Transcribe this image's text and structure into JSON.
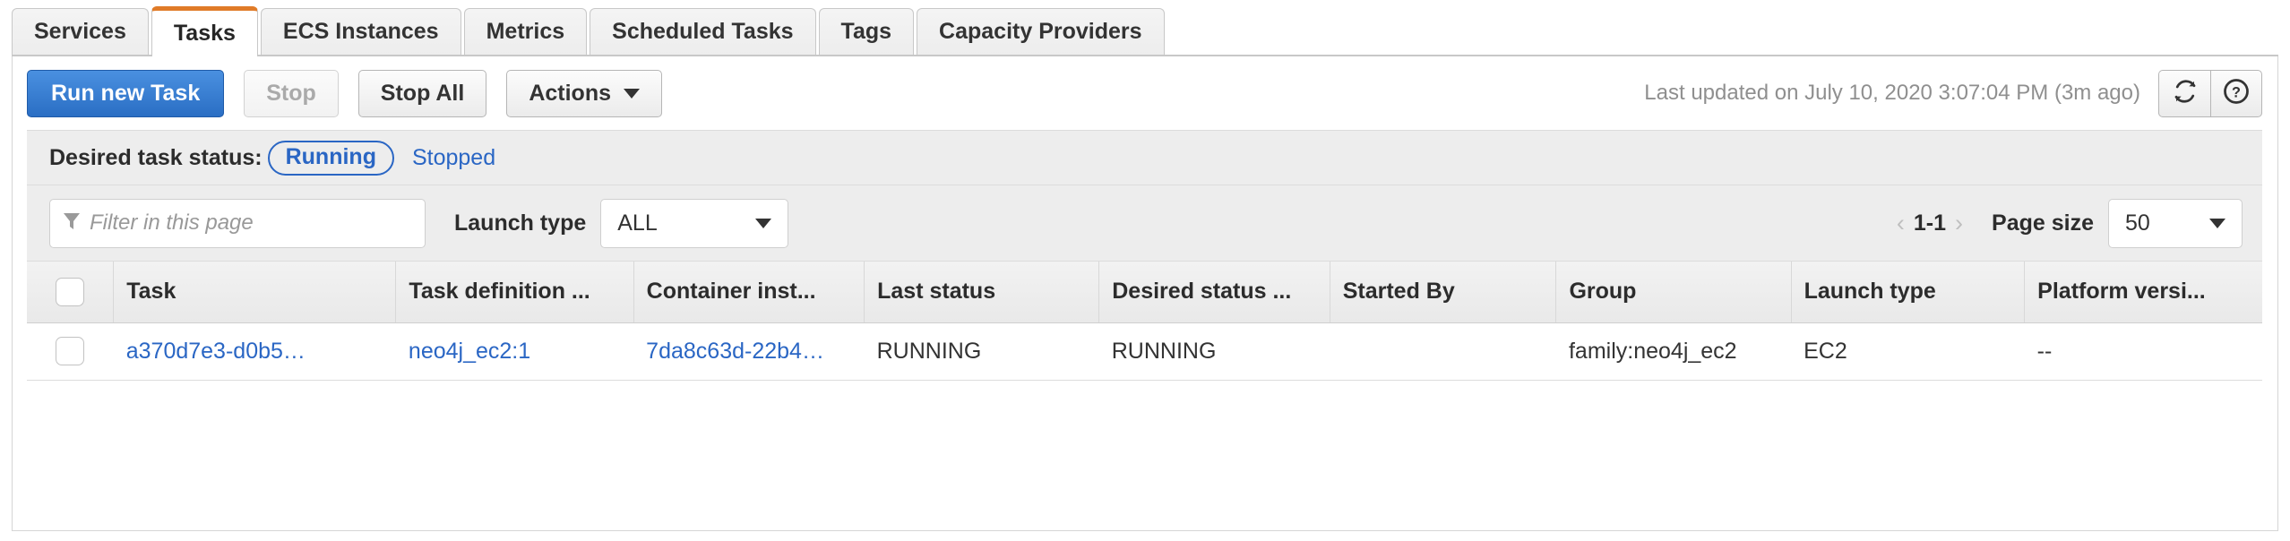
{
  "tabs": [
    {
      "label": "Services",
      "active": false
    },
    {
      "label": "Tasks",
      "active": true
    },
    {
      "label": "ECS Instances",
      "active": false
    },
    {
      "label": "Metrics",
      "active": false
    },
    {
      "label": "Scheduled Tasks",
      "active": false
    },
    {
      "label": "Tags",
      "active": false
    },
    {
      "label": "Capacity Providers",
      "active": false
    }
  ],
  "toolbar": {
    "run_new_task": "Run new Task",
    "stop": "Stop",
    "stop_all": "Stop All",
    "actions": "Actions",
    "last_updated": "Last updated on July 10, 2020 3:07:04 PM (3m ago)",
    "refresh_icon": "refresh-icon",
    "help_icon": "help-icon"
  },
  "filters": {
    "desired_task_status_label": "Desired task status:",
    "status_running": "Running",
    "status_stopped": "Stopped",
    "filter_placeholder": "Filter in this page",
    "filter_value": "",
    "filter_icon": "funnel-icon",
    "launch_type_label": "Launch type",
    "launch_type_value": "ALL",
    "page_range": "1-1",
    "prev_icon": "chevron-left-icon",
    "next_icon": "chevron-right-icon",
    "page_size_label": "Page size",
    "page_size_value": "50"
  },
  "table": {
    "columns": [
      "Task",
      "Task definition ...",
      "Container inst...",
      "Last status",
      "Desired status ...",
      "Started By",
      "Group",
      "Launch type",
      "Platform versi..."
    ],
    "rows": [
      {
        "task": "a370d7e3-d0b5…",
        "task_definition": "neo4j_ec2:1",
        "container_instance": "7da8c63d-22b4…",
        "last_status": "RUNNING",
        "desired_status": "RUNNING",
        "started_by": "",
        "group": "family:neo4j_ec2",
        "launch_type": "EC2",
        "platform_version": "--"
      }
    ]
  },
  "colors": {
    "accent_orange": "#e07b28",
    "link_blue": "#2a66c4",
    "status_green": "#1f9d3f"
  }
}
